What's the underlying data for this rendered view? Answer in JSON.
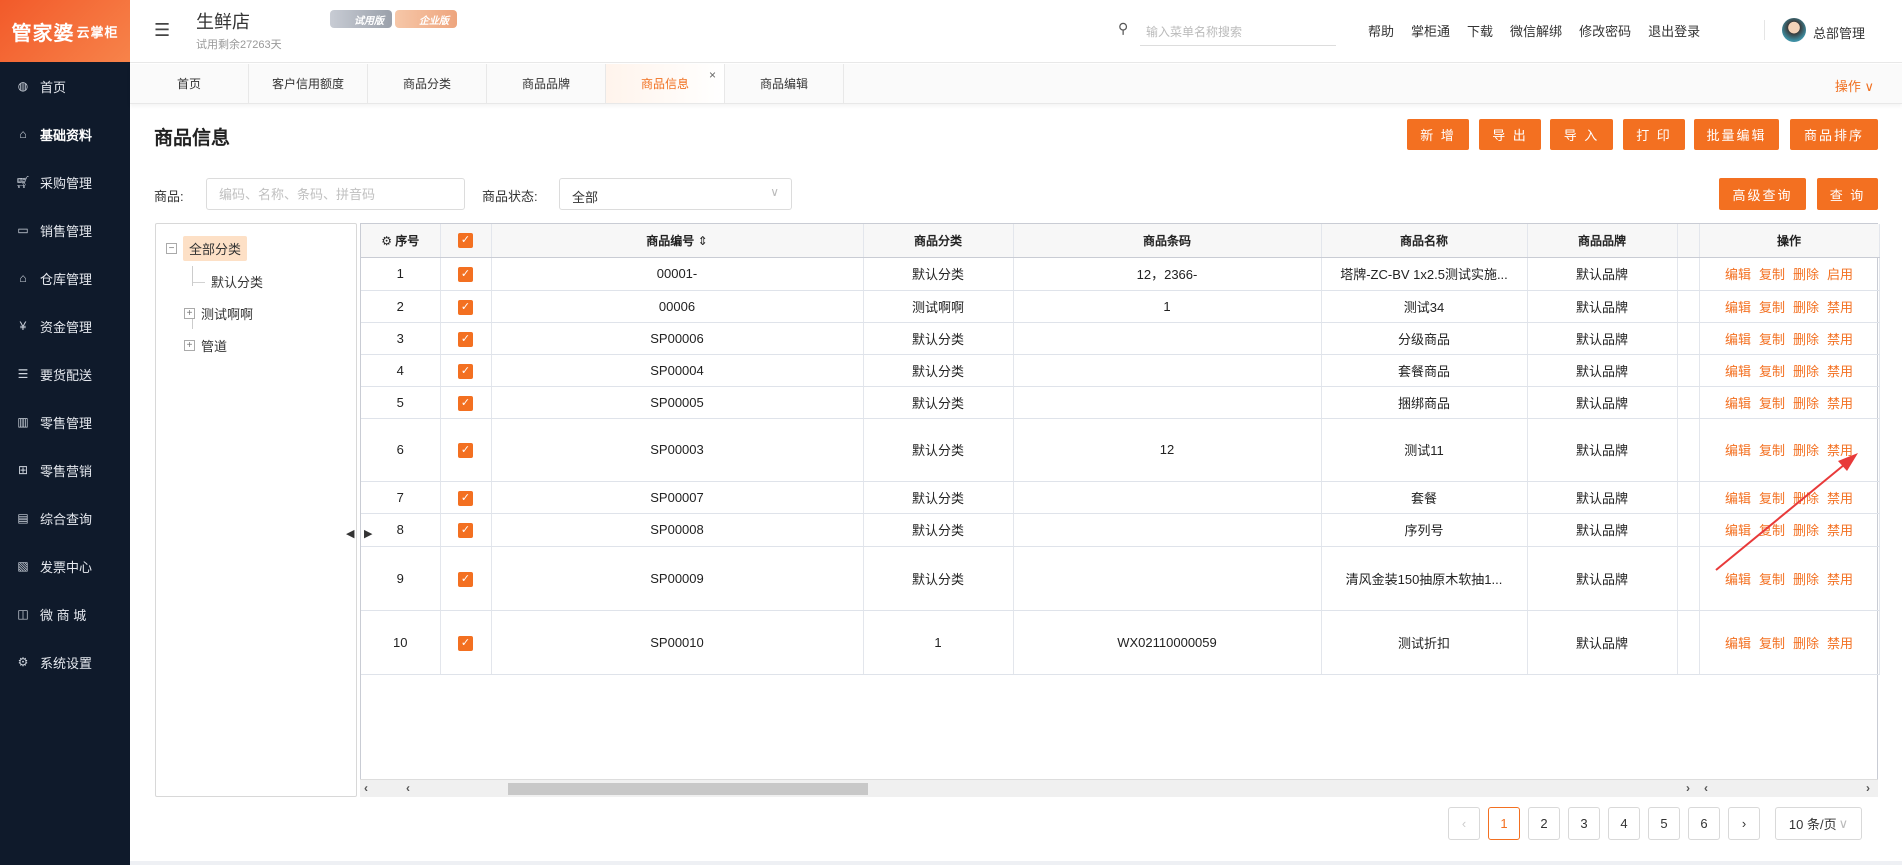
{
  "logo": {
    "brand": "管家婆",
    "sub": "云掌柜"
  },
  "sidebar": {
    "items": [
      {
        "label": "首页",
        "icon": "globe-icon"
      },
      {
        "label": "基础资料",
        "icon": "home-icon"
      },
      {
        "label": "采购管理",
        "icon": "cart-icon"
      },
      {
        "label": "销售管理",
        "icon": "sales-icon"
      },
      {
        "label": "仓库管理",
        "icon": "warehouse-icon"
      },
      {
        "label": "资金管理",
        "icon": "money-icon"
      },
      {
        "label": "要货配送",
        "icon": "list-icon"
      },
      {
        "label": "零售管理",
        "icon": "chart-icon"
      },
      {
        "label": "零售营销",
        "icon": "gift-icon"
      },
      {
        "label": "综合查询",
        "icon": "bar-chart-icon"
      },
      {
        "label": "发票中心",
        "icon": "invoice-icon"
      },
      {
        "label": "微 商 城",
        "icon": "bag-icon"
      },
      {
        "label": "系统设置",
        "icon": "gear-icon"
      }
    ]
  },
  "header": {
    "store": "生鲜店",
    "badge_trial": "试用版",
    "badge_enterprise": "企业版",
    "trial_remaining": "试用剩余27263天",
    "search_placeholder": "输入菜单名称搜索",
    "links": [
      "帮助",
      "掌柜通",
      "下载",
      "微信解绑",
      "修改密码",
      "退出登录"
    ],
    "user": "总部管理"
  },
  "tabs": [
    {
      "label": "首页"
    },
    {
      "label": "客户信用额度"
    },
    {
      "label": "商品分类"
    },
    {
      "label": "商品品牌"
    },
    {
      "label": "商品信息",
      "active": true
    },
    {
      "label": "商品编辑"
    }
  ],
  "tabs_menu": "操作 ∨",
  "page": {
    "title": "商品信息",
    "buttons": [
      "新 增",
      "导 出",
      "导 入",
      "打 印",
      "批量编辑",
      "商品排序"
    ]
  },
  "filters": {
    "product_label": "商品:",
    "product_placeholder": "编码、名称、条码、拼音码",
    "status_label": "商品状态:",
    "status_value": "全部",
    "advanced": "高级查询",
    "query": "查 询"
  },
  "tree": {
    "root": "全部分类",
    "children": [
      "默认分类",
      "测试啊啊",
      "管道"
    ]
  },
  "table": {
    "columns": [
      "序号",
      "",
      "商品编号",
      "商品分类",
      "商品条码",
      "商品名称",
      "商品品牌",
      "",
      "操作"
    ],
    "rows": [
      {
        "seq": "1",
        "code": "00001-",
        "category": "默认分类",
        "barcode": "12，2366-",
        "name": "塔牌-ZC-BV 1x2.5测试实施...",
        "brand": "默认品牌",
        "toggle": "启用"
      },
      {
        "seq": "2",
        "code": "00006",
        "category": "测试啊啊",
        "barcode": "1",
        "name": "测试34",
        "brand": "默认品牌",
        "toggle": "禁用"
      },
      {
        "seq": "3",
        "code": "SP00006",
        "category": "默认分类",
        "barcode": "",
        "name": "分级商品",
        "brand": "默认品牌",
        "toggle": "禁用"
      },
      {
        "seq": "4",
        "code": "SP00004",
        "category": "默认分类",
        "barcode": "",
        "name": "套餐商品",
        "brand": "默认品牌",
        "toggle": "禁用"
      },
      {
        "seq": "5",
        "code": "SP00005",
        "category": "默认分类",
        "barcode": "",
        "name": "捆绑商品",
        "brand": "默认品牌",
        "toggle": "禁用"
      },
      {
        "seq": "6",
        "code": "SP00003",
        "category": "默认分类",
        "barcode": "12",
        "name": "测试11",
        "brand": "默认品牌",
        "toggle": "禁用"
      },
      {
        "seq": "7",
        "code": "SP00007",
        "category": "默认分类",
        "barcode": "",
        "name": "套餐",
        "brand": "默认品牌",
        "toggle": "禁用"
      },
      {
        "seq": "8",
        "code": "SP00008",
        "category": "默认分类",
        "barcode": "",
        "name": "序列号",
        "brand": "默认品牌",
        "toggle": "禁用"
      },
      {
        "seq": "9",
        "code": "SP00009",
        "category": "默认分类",
        "barcode": "",
        "name": "清风金装150抽原木软抽1...",
        "brand": "默认品牌",
        "toggle": "禁用"
      },
      {
        "seq": "10",
        "code": "SP00010",
        "category": "1",
        "barcode": "WX02110000059",
        "name": "测试折扣",
        "brand": "默认品牌",
        "toggle": "禁用"
      }
    ],
    "ops": [
      "编辑",
      "复制",
      "删除"
    ]
  },
  "pagination": {
    "pages": [
      "1",
      "2",
      "3",
      "4",
      "5",
      "6"
    ],
    "current": "1",
    "page_size": "10 条/页"
  },
  "colors": {
    "accent": "#f37021",
    "sidebar": "#0f1a2b"
  }
}
